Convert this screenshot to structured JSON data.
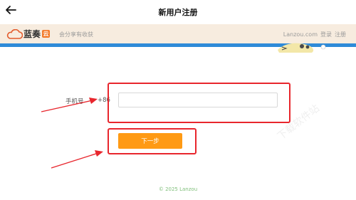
{
  "app_bar": {
    "back_icon": "arrow-left-icon",
    "title": "新用户注册"
  },
  "site_header": {
    "logo_text": "蓝奏",
    "logo_badge": "云",
    "slogan": "会分享有收获",
    "brand_link": "Lanzou.com",
    "login_link": "登录",
    "register_link": "注册"
  },
  "form": {
    "phone_label": "手机号",
    "country_code": "+86",
    "phone_value": "",
    "next_button": "下一步"
  },
  "footer": {
    "copyright": "© 2025 Lanzou"
  },
  "watermark": "下载软件站",
  "colors": {
    "header_bg": "#f7ecdf",
    "band": "#2f8bd8",
    "accent_orange": "#ff9a14",
    "annotation_red": "#e8262d",
    "footer_green": "#7fbf7a"
  }
}
